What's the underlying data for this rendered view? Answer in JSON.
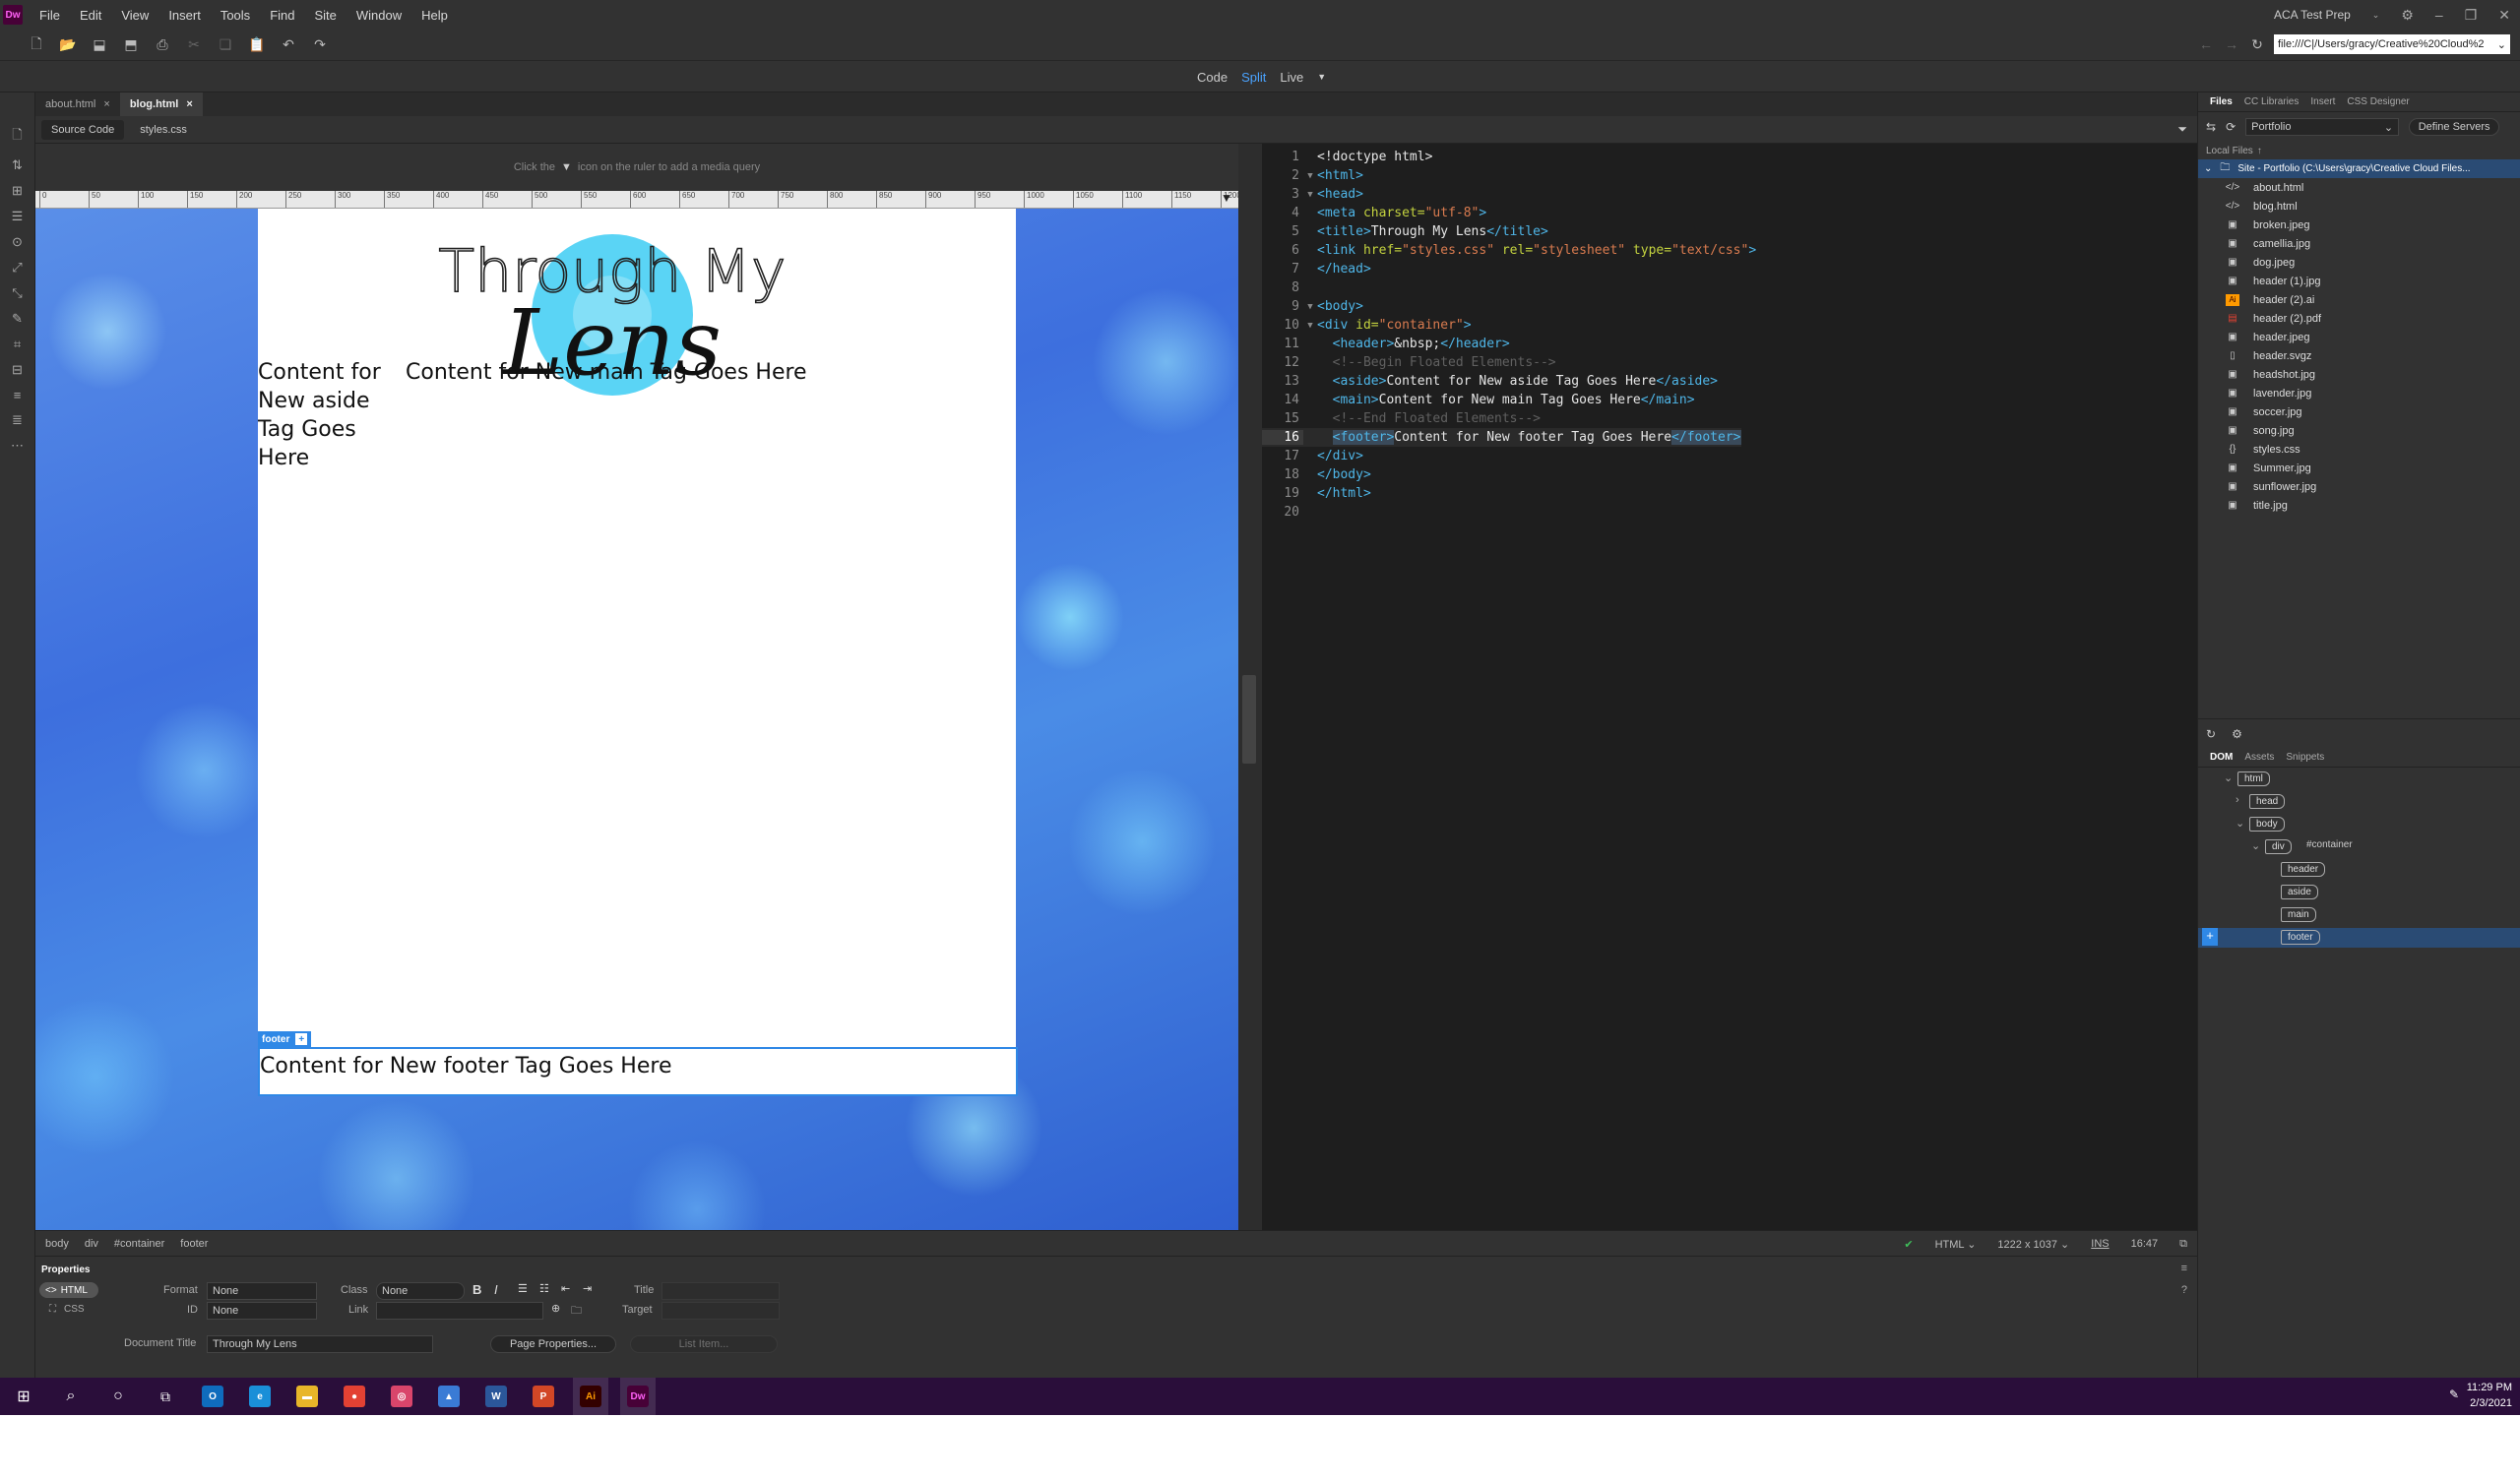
{
  "app": {
    "logo": "Dw",
    "account": "ACA Test Prep",
    "address": "file:///C|/Users/gracy/Creative%20Cloud%2"
  },
  "menu": [
    "File",
    "Edit",
    "View",
    "Insert",
    "Tools",
    "Find",
    "Site",
    "Window",
    "Help"
  ],
  "view_modes": {
    "code": "Code",
    "split": "Split",
    "live": "Live"
  },
  "tabs": [
    {
      "label": "about.html"
    },
    {
      "label": "blog.html"
    }
  ],
  "related": {
    "source": "Source Code",
    "css": "styles.css"
  },
  "media_query_hint": {
    "before": "Click the",
    "after": "icon on the ruler to add a media query"
  },
  "ruler": [
    "0",
    "50",
    "100",
    "150",
    "200",
    "250",
    "300",
    "350",
    "400",
    "450",
    "500",
    "550",
    "600",
    "650",
    "700",
    "750",
    "800",
    "850",
    "900",
    "950",
    "1000",
    "1050",
    "1100",
    "1150",
    "1200"
  ],
  "page": {
    "logo_line1": "Through My",
    "logo_line2": "Lens",
    "aside": "Content for New aside Tag Goes Here",
    "main": "Content for New main Tag Goes Here",
    "footer_label": "footer",
    "footer": "Content for New footer Tag Goes Here"
  },
  "code_lines": [
    {
      "n": "1",
      "f": "",
      "html": [
        [
          "txt",
          "<!doctype html>"
        ]
      ]
    },
    {
      "n": "2",
      "f": "▼",
      "html": [
        [
          "tag",
          "<html>"
        ]
      ]
    },
    {
      "n": "3",
      "f": "▼",
      "html": [
        [
          "tag",
          "<head>"
        ]
      ]
    },
    {
      "n": "4",
      "f": "",
      "html": [
        [
          "tag",
          "<meta "
        ],
        [
          "attr",
          "charset="
        ],
        [
          "str",
          "\"utf-8\""
        ],
        [
          "tag",
          ">"
        ]
      ]
    },
    {
      "n": "5",
      "f": "",
      "html": [
        [
          "tag",
          "<title>"
        ],
        [
          "txt",
          "Through My Lens"
        ],
        [
          "tag",
          "</title>"
        ]
      ]
    },
    {
      "n": "6",
      "f": "",
      "html": [
        [
          "tag",
          "<link "
        ],
        [
          "attr",
          "href="
        ],
        [
          "str",
          "\"styles.css\" "
        ],
        [
          "attr",
          "rel="
        ],
        [
          "str",
          "\"stylesheet\" "
        ],
        [
          "attr",
          "type="
        ],
        [
          "str",
          "\"text/css\""
        ],
        [
          "tag",
          ">"
        ]
      ]
    },
    {
      "n": "7",
      "f": "",
      "html": [
        [
          "tag",
          "</head>"
        ]
      ]
    },
    {
      "n": "8",
      "f": "",
      "html": []
    },
    {
      "n": "9",
      "f": "▼",
      "html": [
        [
          "tag",
          "<body>"
        ]
      ]
    },
    {
      "n": "10",
      "f": "▼",
      "html": [
        [
          "tag",
          "<div "
        ],
        [
          "attr",
          "id="
        ],
        [
          "str",
          "\"container\""
        ],
        [
          "tag",
          ">"
        ]
      ]
    },
    {
      "n": "11",
      "f": "",
      "html": [
        [
          "txt",
          "  "
        ],
        [
          "tag",
          "<header>"
        ],
        [
          "txt",
          "&nbsp;"
        ],
        [
          "tag",
          "</header>"
        ]
      ]
    },
    {
      "n": "12",
      "f": "",
      "html": [
        [
          "txt",
          "  "
        ],
        [
          "cmt",
          "<!--Begin Floated Elements-->"
        ]
      ]
    },
    {
      "n": "13",
      "f": "",
      "html": [
        [
          "txt",
          "  "
        ],
        [
          "tag",
          "<aside>"
        ],
        [
          "txt",
          "Content for New aside Tag Goes Here"
        ],
        [
          "tag",
          "</aside>"
        ]
      ]
    },
    {
      "n": "14",
      "f": "",
      "html": [
        [
          "txt",
          "  "
        ],
        [
          "tag",
          "<main>"
        ],
        [
          "txt",
          "Content for New main Tag Goes Here"
        ],
        [
          "tag",
          "</main>"
        ]
      ]
    },
    {
      "n": "15",
      "f": "",
      "html": [
        [
          "txt",
          "  "
        ],
        [
          "cmt",
          "<!--End Floated Elements-->"
        ]
      ]
    },
    {
      "n": "16",
      "f": "",
      "html": [
        [
          "txt",
          "  "
        ],
        [
          "tag",
          "<footer>"
        ],
        [
          "txt",
          "Content for New footer Tag Goes Here"
        ],
        [
          "tag",
          "</footer>"
        ]
      ]
    },
    {
      "n": "17",
      "f": "",
      "html": [
        [
          "tag",
          "</div>"
        ]
      ]
    },
    {
      "n": "18",
      "f": "",
      "html": [
        [
          "tag",
          "</body>"
        ]
      ]
    },
    {
      "n": "19",
      "f": "",
      "html": [
        [
          "tag",
          "</html>"
        ]
      ]
    },
    {
      "n": "20",
      "f": "",
      "html": []
    }
  ],
  "status": {
    "crumbs": [
      "body",
      "div",
      "#container",
      "footer"
    ],
    "lang": "HTML",
    "size": "1222 x 1037",
    "mode": "INS",
    "pos": "16:47"
  },
  "properties": {
    "title": "Properties",
    "html_btn": "HTML",
    "css_btn": "CSS",
    "format_label": "Format",
    "format_value": "None",
    "id_label": "ID",
    "id_value": "None",
    "class_label": "Class",
    "class_value": "None",
    "link_label": "Link",
    "title_label": "Title",
    "target_label": "Target",
    "doc_title_label": "Document Title",
    "doc_title_value": "Through My Lens",
    "page_props": "Page Properties...",
    "list_item": "List Item..."
  },
  "files_panel": {
    "tabs": [
      "Files",
      "CC Libraries",
      "Insert",
      "CSS Designer"
    ],
    "site": "Portfolio",
    "define": "Define Servers",
    "local": "Local Files",
    "root": "Site - Portfolio (C:\\Users\\gracy\\Creative Cloud Files...",
    "files": [
      {
        "name": "about.html",
        "icon": "code"
      },
      {
        "name": "blog.html",
        "icon": "code"
      },
      {
        "name": "broken.jpeg",
        "icon": "img"
      },
      {
        "name": "camellia.jpg",
        "icon": "img"
      },
      {
        "name": "dog.jpeg",
        "icon": "img"
      },
      {
        "name": "header (1).jpg",
        "icon": "img"
      },
      {
        "name": "header (2).ai",
        "icon": "ai"
      },
      {
        "name": "header (2).pdf",
        "icon": "pdf"
      },
      {
        "name": "header.jpeg",
        "icon": "img"
      },
      {
        "name": "header.svgz",
        "icon": "doc"
      },
      {
        "name": "headshot.jpg",
        "icon": "img"
      },
      {
        "name": "lavender.jpg",
        "icon": "img"
      },
      {
        "name": "soccer.jpg",
        "icon": "img"
      },
      {
        "name": "song.jpg",
        "icon": "img"
      },
      {
        "name": "styles.css",
        "icon": "css"
      },
      {
        "name": "Summer.jpg",
        "icon": "img"
      },
      {
        "name": "sunflower.jpg",
        "icon": "img"
      },
      {
        "name": "title.jpg",
        "icon": "img"
      }
    ]
  },
  "dom_panel": {
    "tabs": [
      "DOM",
      "Assets",
      "Snippets"
    ],
    "nodes": [
      {
        "tag": "html",
        "extra": ""
      },
      {
        "tag": "head",
        "extra": ""
      },
      {
        "tag": "body",
        "extra": ""
      },
      {
        "tag": "div",
        "extra": "#container"
      },
      {
        "tag": "header",
        "extra": ""
      },
      {
        "tag": "aside",
        "extra": ""
      },
      {
        "tag": "main",
        "extra": ""
      },
      {
        "tag": "footer",
        "extra": ""
      }
    ]
  },
  "taskbar": {
    "time": "11:29 PM",
    "date": "2/3/2021",
    "apps": [
      {
        "label": "O",
        "color": "#0f6cbd"
      },
      {
        "label": "e",
        "color": "#1a8fd8"
      },
      {
        "label": "▬",
        "color": "#e8b629"
      },
      {
        "label": "●",
        "color": "#e34133"
      },
      {
        "label": "◎",
        "color": "#d9456b"
      },
      {
        "label": "▲",
        "color": "#3a7bd5"
      },
      {
        "label": "W",
        "color": "#2b579a"
      },
      {
        "label": "P",
        "color": "#d24726"
      },
      {
        "label": "Ai",
        "color": "#330000"
      },
      {
        "label": "Dw",
        "color": "#470137"
      }
    ]
  },
  "colors": {
    "accent": "#2f88e6",
    "split_active": "#4aa3ff"
  }
}
